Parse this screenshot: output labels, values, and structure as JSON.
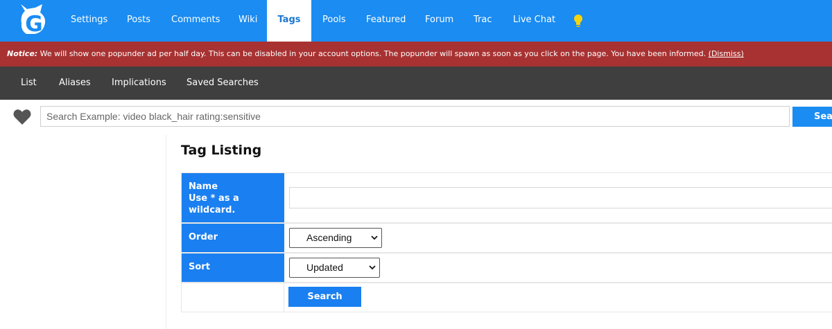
{
  "nav": {
    "items": [
      {
        "label": "Settings"
      },
      {
        "label": "Posts"
      },
      {
        "label": "Comments"
      },
      {
        "label": "Wiki"
      },
      {
        "label": "Tags"
      },
      {
        "label": "Pools"
      },
      {
        "label": "Featured"
      },
      {
        "label": "Forum"
      },
      {
        "label": "Trac"
      },
      {
        "label": "Live Chat"
      }
    ],
    "active": "Tags",
    "logo_letter": "G"
  },
  "notice": {
    "prefix": "Notice:",
    "text": " We will show one popunder ad per half day. This can be disabled in your account options. The popunder will spawn as soon as you click on the page. You have been informed. ",
    "dismiss": "(Dismiss)"
  },
  "subnav": {
    "items": [
      {
        "label": "List"
      },
      {
        "label": "Aliases"
      },
      {
        "label": "Implications"
      },
      {
        "label": "Saved Searches"
      }
    ]
  },
  "search": {
    "placeholder": "Search Example: video black_hair rating:sensitive",
    "button": "Search"
  },
  "page": {
    "title": "Tag Listing"
  },
  "form": {
    "name_label_1": "Name",
    "name_label_2": "Use * as a wildcard.",
    "name_value": "",
    "order_label": "Order",
    "order_value": "Ascending",
    "sort_label": "Sort",
    "sort_value": "Updated",
    "submit": "Search"
  },
  "colors": {
    "nav_bg": "#1a8cf2",
    "notice_bg": "#a83232",
    "subnav_bg": "#3f3f3f",
    "label_bg": "#1a7ff0",
    "bulb": "#f5d40c"
  }
}
